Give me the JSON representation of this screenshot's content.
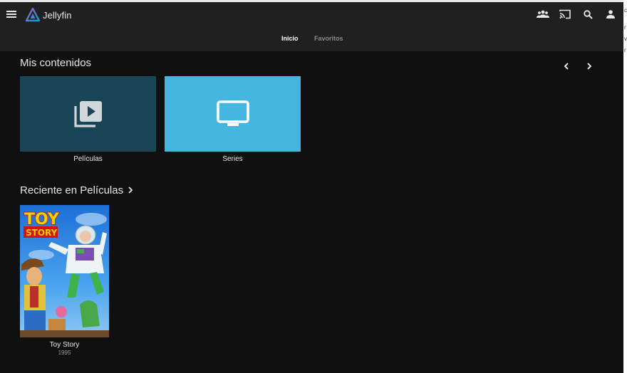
{
  "app": {
    "name": "Jellyfin"
  },
  "tabs": [
    {
      "label": "Inicio",
      "active": true
    },
    {
      "label": "Favoritos",
      "active": false
    }
  ],
  "my_media": {
    "title": "Mis contenidos",
    "libraries": [
      {
        "label": "Películas",
        "icon": "video-library-icon",
        "color": "#1a4556"
      },
      {
        "label": "Series",
        "icon": "tv-icon",
        "color": "#44b6e0"
      }
    ]
  },
  "recent": {
    "title": "Reciente en Películas",
    "items": [
      {
        "title": "Toy Story",
        "year": "1995",
        "poster_title_top": "TOY",
        "poster_title_bottom": "STORY"
      }
    ]
  },
  "header_icons": [
    "menu-icon",
    "users-icon",
    "cast-icon",
    "search-icon",
    "user-icon"
  ],
  "colors": {
    "accent_purple": "#aa5cc3",
    "accent_blue": "#00a4dc",
    "background": "#101010",
    "header": "#202020"
  },
  "right_edge_glyphs": [
    "c",
    "r",
    "v",
    "r"
  ]
}
